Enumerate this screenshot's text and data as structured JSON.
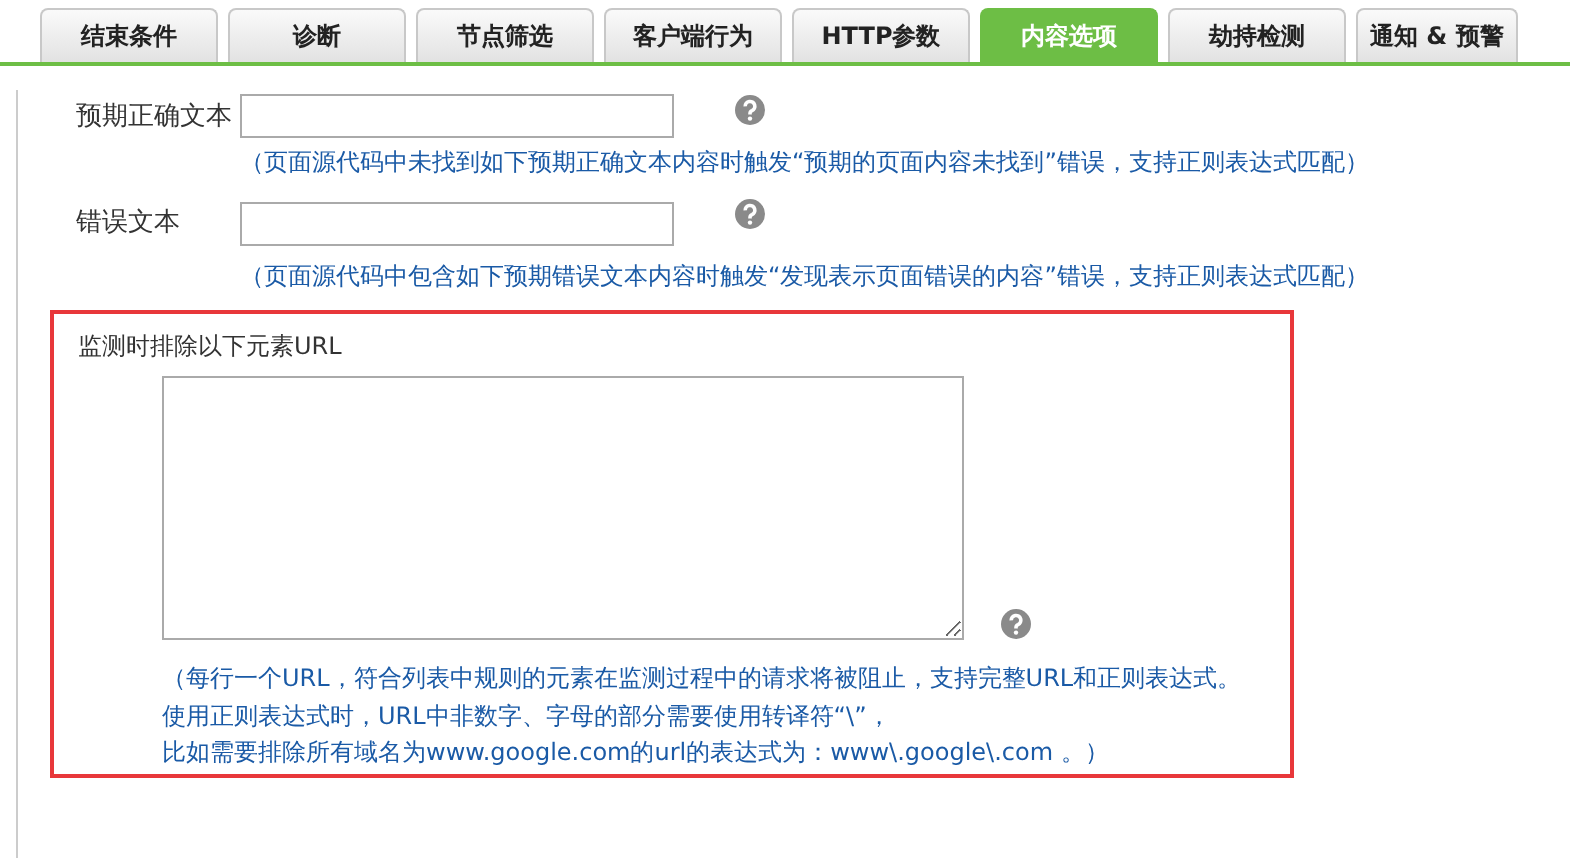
{
  "tabs": [
    {
      "label": "结束条件",
      "selected": false
    },
    {
      "label": "诊断",
      "selected": false
    },
    {
      "label": "节点筛选",
      "selected": false
    },
    {
      "label": "客户端行为",
      "selected": false
    },
    {
      "label": "HTTP参数",
      "selected": false
    },
    {
      "label": "内容选项",
      "selected": true
    },
    {
      "label": "劫持检测",
      "selected": false
    },
    {
      "label": "通知 & 预警",
      "selected": false
    }
  ],
  "fields": [
    {
      "label": "预期正确文本",
      "hint": "（页面源代码中未找到如下预期正确文本内容时触发“预期的页面内容未找到”错误，支持正则表达式匹配）"
    },
    {
      "label": "错误文本",
      "hint": "（页面源代码中包含如下预期错误文本内容时触发“发现表示页面错误的内容”错误，支持正则表达式匹配）"
    }
  ],
  "exclude": {
    "label": "监测时排除以下元素URL",
    "hint_lines": [
      "（每行一个URL，符合列表中规则的元素在监测过程中的请求将被阻止，支持完整URL和正则表达式。",
      "使用正则表达式时，URL中非数字、字母的部分需要使用转译符“\\”，",
      "比如需要排除所有域名为www.google.com的url的表达式为：www\\.google\\.com 。）"
    ]
  }
}
